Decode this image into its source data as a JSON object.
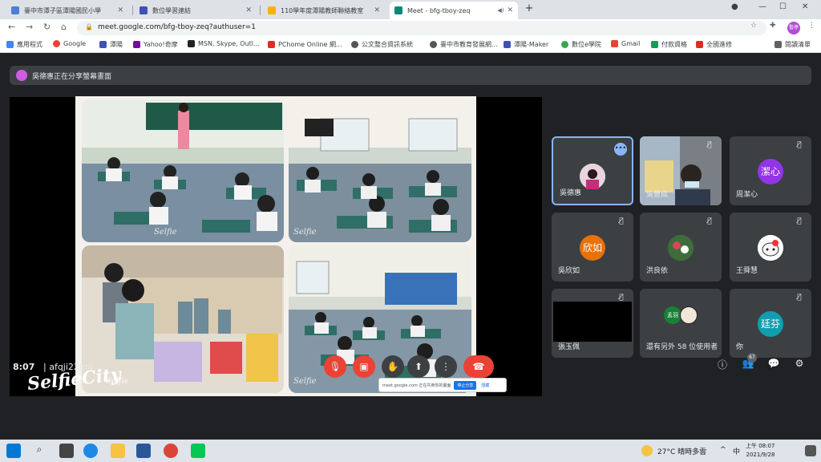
{
  "browser": {
    "tabs": [
      {
        "label": "臺中市潭子區潭陽國民小學",
        "active": false
      },
      {
        "label": "數位學習連結",
        "active": false
      },
      {
        "label": "110學年度潭陽教師聯絡教室",
        "active": false
      },
      {
        "label": "Meet - bfg-tboy-zeq",
        "active": true
      }
    ],
    "new_tab": "+",
    "url": "meet.google.com/bfg-tboy-zeq?authuser=1",
    "profile": "暫停",
    "bookmarks": [
      "應用程式",
      "Google",
      "潭陽",
      "Yahoo!奇摩",
      "MSN, Skype, Outl...",
      "PChome Online 網...",
      "公文整合資訊系統",
      "臺中市教育發展網...",
      "潭陽-Maker",
      "數位e學院",
      "Gmail",
      "付款資格",
      "全國進修"
    ],
    "reading_list": "閱讀清單"
  },
  "meet": {
    "share_banner": "吳德惠正在分享螢幕畫面",
    "time": "8:07",
    "meeting_code": "| afqji22iml",
    "participant_count": "67",
    "sharebar": {
      "text": "meet.google.com 正在共用你的畫面",
      "stop": "停止分享",
      "hide": "隱藏"
    },
    "tiles": [
      {
        "name": "吳德惠",
        "avatar": "",
        "color": "#3c4043",
        "speaking": true
      },
      {
        "name": "吳豐成",
        "avatar": "",
        "color": "#6b6b6b",
        "speaking": false
      },
      {
        "name": "周潔心",
        "avatar": "潔心",
        "color": "#9334e6",
        "speaking": false
      },
      {
        "name": "吳欣如",
        "avatar": "欣如",
        "color": "#e8710a",
        "speaking": false
      },
      {
        "name": "洪良依",
        "avatar": "",
        "color": "#5b8a3c",
        "speaking": false
      },
      {
        "name": "王舜慧",
        "avatar": "",
        "color": "#ffffff",
        "speaking": false
      },
      {
        "name": "張玉佩",
        "avatar": "",
        "color": "#000000",
        "speaking": false
      },
      {
        "name": "還有另外 58 位使用者",
        "avatar": "孟羽",
        "color": "#188038",
        "speaking": false
      },
      {
        "name": "你",
        "avatar": "廷芬",
        "color": "#129eaf",
        "speaking": false
      }
    ]
  },
  "watermark": "SelfieCity",
  "photo_watermark": "Selfie",
  "taskbar": {
    "weather": "27°C 晴時多雲",
    "ime": "中",
    "time": "上午 08:07",
    "date": "2021/9/28"
  },
  "colors": {
    "accent": "#8ab4f8",
    "danger": "#ea4335",
    "panel": "#3c4043"
  }
}
